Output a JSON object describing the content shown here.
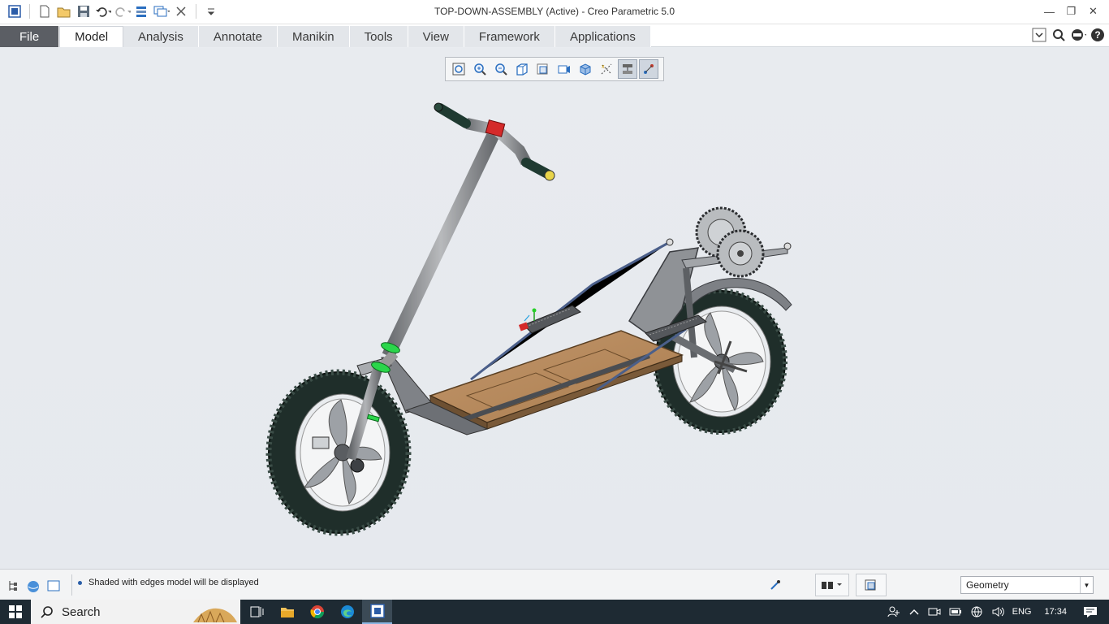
{
  "window": {
    "title": "TOP-DOWN-ASSEMBLY (Active) - Creo Parametric 5.0"
  },
  "ribbon": {
    "tabs": [
      {
        "label": "File"
      },
      {
        "label": "Model"
      },
      {
        "label": "Analysis"
      },
      {
        "label": "Annotate"
      },
      {
        "label": "Manikin"
      },
      {
        "label": "Tools"
      },
      {
        "label": "View"
      },
      {
        "label": "Framework"
      },
      {
        "label": "Applications"
      }
    ],
    "active_tab": "Model"
  },
  "view_toolbar": {
    "icons": [
      "refit-icon",
      "zoom-in-icon",
      "zoom-out-icon",
      "repaint-icon",
      "saved-orientations-icon",
      "view-manager-icon",
      "display-style-icon",
      "datum-display-icon",
      "spin-center-icon",
      "annotation-display-icon"
    ]
  },
  "status": {
    "message": "Shaded with edges model will be displayed",
    "filter_value": "Geometry"
  },
  "taskbar": {
    "search_placeholder": "Search",
    "language": "ENG",
    "time": "17:34"
  },
  "colors": {
    "accent": "#2a5ea8",
    "deck": "#b5875a",
    "tire": "#1f2e2a",
    "frame": "#8f9296",
    "taskbar": "#1e2a33"
  }
}
